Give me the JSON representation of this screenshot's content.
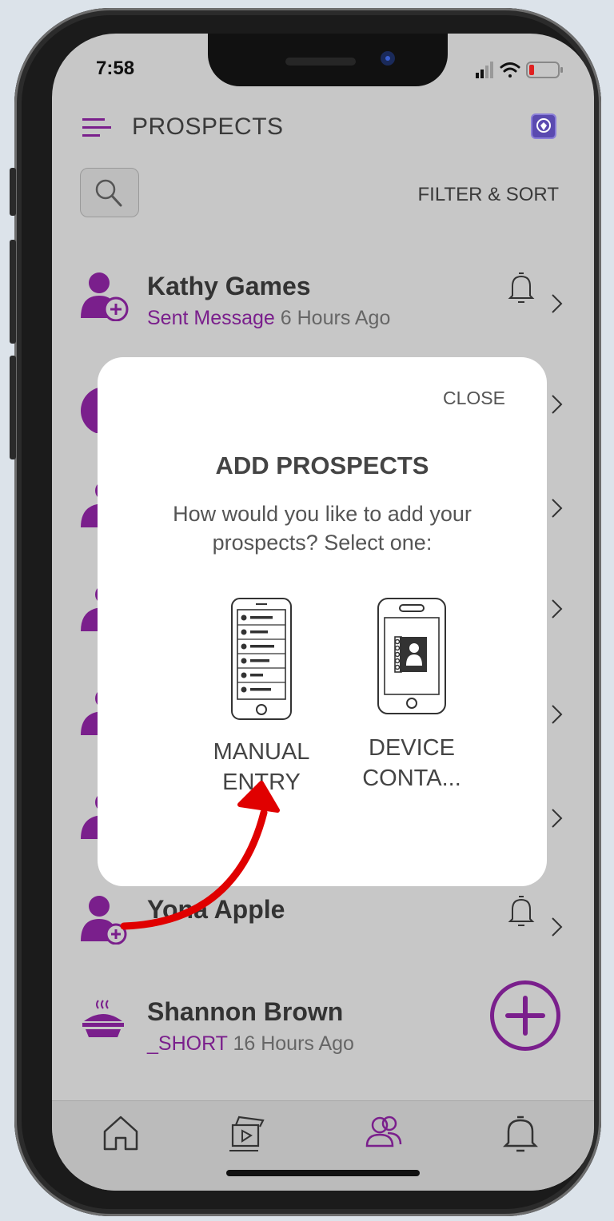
{
  "status_bar": {
    "time": "7:58"
  },
  "header": {
    "title": "PROSPECTS",
    "filter_label": "FILTER & SORT"
  },
  "prospects": [
    {
      "name": "Kathy Games",
      "activity": "Sent Message",
      "ago": "6 Hours Ago"
    },
    {
      "name": "Yona  Apple",
      "activity": "",
      "ago": ""
    },
    {
      "name": "Shannon Brown",
      "activity": "_SHORT",
      "ago": "16 Hours Ago"
    }
  ],
  "modal": {
    "close_label": "CLOSE",
    "title": "ADD PROSPECTS",
    "description": "How would you like to add your prospects? Select one:",
    "options": [
      {
        "line1": "MANUAL",
        "line2": "ENTRY"
      },
      {
        "line1": "DEVICE",
        "line2": "CONTA..."
      }
    ]
  },
  "tabs": [
    {
      "icon": "home-icon"
    },
    {
      "icon": "media-icon"
    },
    {
      "icon": "people-icon",
      "active": true
    },
    {
      "icon": "bell-icon"
    }
  ],
  "colors": {
    "accent": "#7a1f8c",
    "overlay": "#c7c7c7",
    "arrow": "#e00000"
  }
}
